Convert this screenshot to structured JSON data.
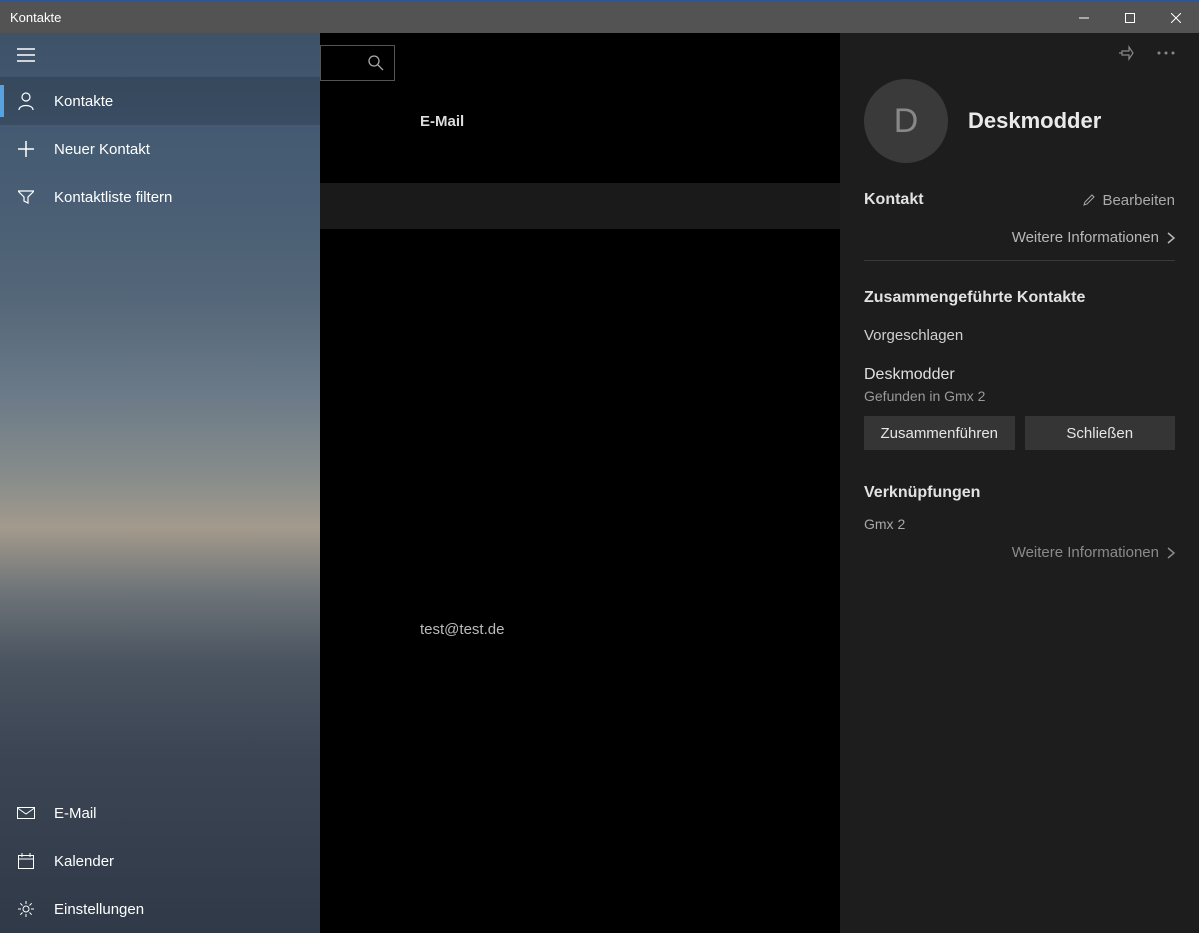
{
  "window": {
    "title": "Kontakte"
  },
  "sidebar": {
    "nav": [
      {
        "label": "Kontakte"
      },
      {
        "label": "Neuer Kontakt"
      },
      {
        "label": "Kontaktliste filtern"
      }
    ],
    "bottom": [
      {
        "label": "E-Mail"
      },
      {
        "label": "Kalender"
      },
      {
        "label": "Einstellungen"
      }
    ]
  },
  "middle": {
    "tab_label": "E-Mail",
    "email_value": "test@test.de"
  },
  "detail": {
    "avatar_initial": "D",
    "name": "Deskmodder",
    "section_contact": "Kontakt",
    "edit_label": "Bearbeiten",
    "more_info": "Weitere Informationen",
    "merged_title": "Zusammengeführte Kontakte",
    "suggested_label": "Vorgeschlagen",
    "merged_contact_name": "Deskmodder",
    "merged_contact_sub": "Gefunden in Gmx 2",
    "merge_btn": "Zusammenführen",
    "close_btn": "Schließen",
    "links_title": "Verknüpfungen",
    "link_item": "Gmx 2",
    "more_info2": "Weitere Informationen"
  }
}
